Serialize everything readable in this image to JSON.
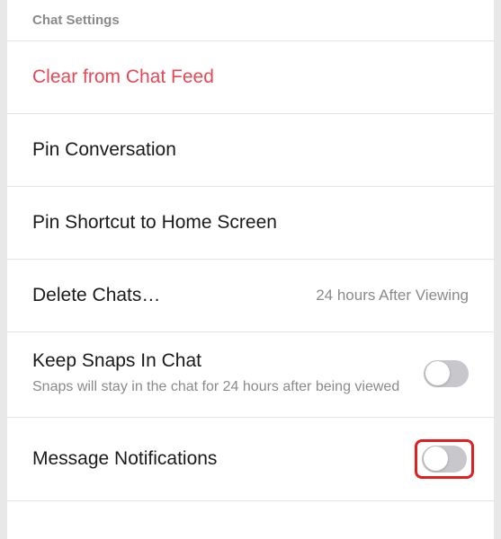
{
  "header": {
    "title": "Chat Settings"
  },
  "rows": {
    "clear": {
      "label": "Clear from Chat Feed"
    },
    "pinConversation": {
      "label": "Pin Conversation"
    },
    "pinShortcut": {
      "label": "Pin Shortcut to Home Screen"
    },
    "deleteChats": {
      "label": "Delete Chats…",
      "value": "24 hours After Viewing"
    },
    "keepSnaps": {
      "label": "Keep Snaps In Chat",
      "sublabel": "Snaps will stay in the chat for 24 hours after being viewed",
      "toggled": false
    },
    "messageNotifications": {
      "label": "Message Notifications",
      "toggled": false
    }
  }
}
